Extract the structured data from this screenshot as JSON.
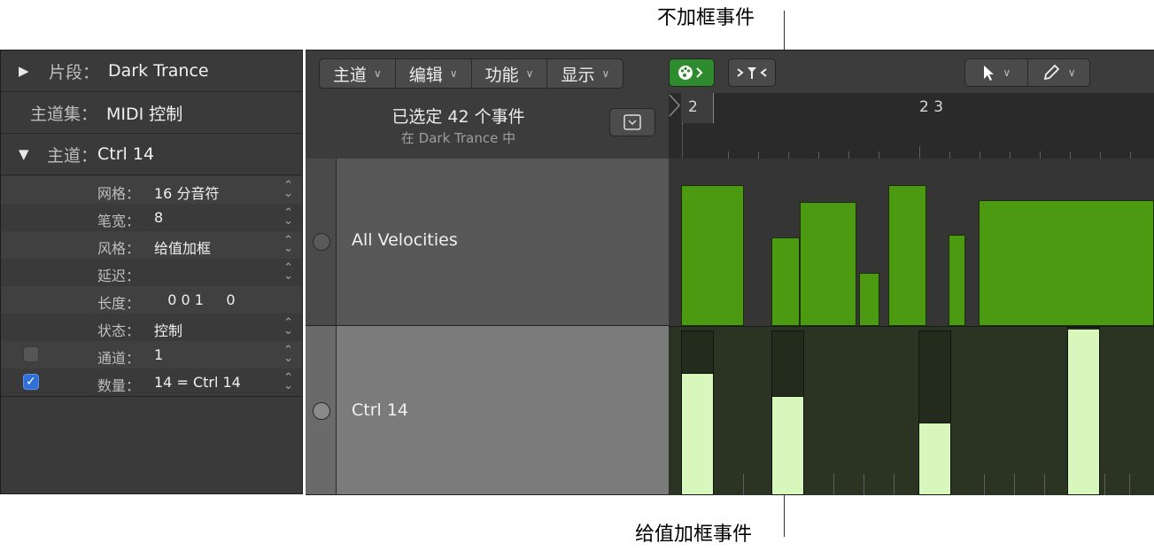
{
  "callouts": {
    "top": "不加框事件",
    "bottom": "给值加框事件"
  },
  "inspector": {
    "region": {
      "key": "片段：",
      "value": "Dark Trance"
    },
    "laneset": {
      "key": "主道集：",
      "value": "MIDI 控制"
    },
    "lane": {
      "key": "主道：",
      "value": "Ctrl 14"
    },
    "params": [
      {
        "key": "网格：",
        "value": "16 分音符"
      },
      {
        "key": "笔宽：",
        "value": "8"
      },
      {
        "key": "风格：",
        "value": "给值加框"
      },
      {
        "key": "延迟：",
        "value": ""
      },
      {
        "key": "长度：",
        "value": "   0 0 1     0"
      },
      {
        "key": "状态：",
        "value": "控制"
      },
      {
        "key": "通道：",
        "value": "1"
      },
      {
        "key": "数量：",
        "value": "14 = Ctrl 14"
      }
    ]
  },
  "toolbar": {
    "menus": [
      "主道",
      "编辑",
      "功能",
      "显示"
    ]
  },
  "selection": {
    "title": "已选定 42 个事件",
    "subtitle": "在 Dark Trance 中"
  },
  "ruler": {
    "bar_start": "2",
    "bar_mid": "2 3"
  },
  "lanes": [
    {
      "name": "All Velocities"
    },
    {
      "name": "Ctrl 14"
    }
  ],
  "velocity_events": [
    0.91,
    0.57,
    0.8,
    0.34,
    0.91,
    0.59,
    0.81
  ],
  "controller_events": [
    0.73,
    0.59,
    0.43,
    1.0
  ],
  "colors": {
    "velocity": "#4b9a11",
    "controller": "#d8f7bd",
    "tool_green": "#2e8b2e"
  }
}
